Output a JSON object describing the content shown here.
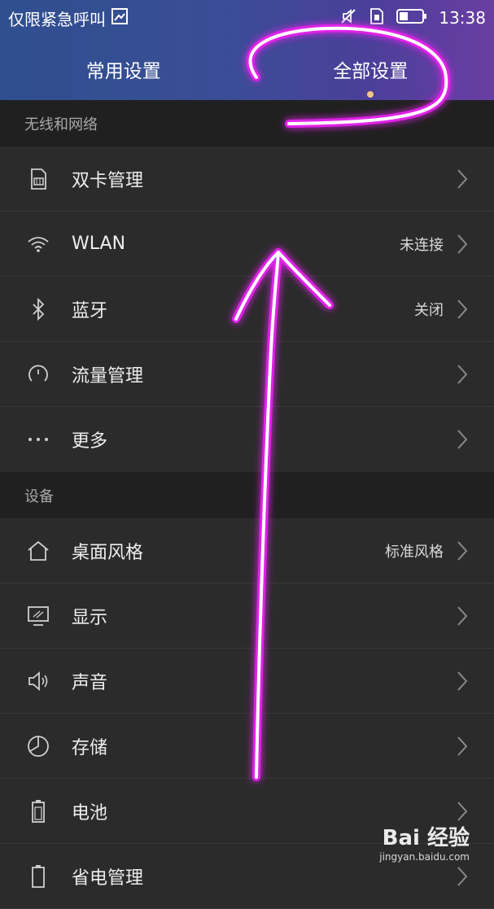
{
  "status_bar": {
    "carrier": "仅限紧急呼叫",
    "time": "13:38"
  },
  "tabs": [
    {
      "label": "常用设置",
      "active": false
    },
    {
      "label": "全部设置",
      "active": true
    }
  ],
  "sections": [
    {
      "header": "无线和网络",
      "items": [
        {
          "label": "双卡管理",
          "value": "",
          "icon": "sim-card-icon"
        },
        {
          "label": "WLAN",
          "value": "未连接",
          "icon": "wifi-icon"
        },
        {
          "label": "蓝牙",
          "value": "关闭",
          "icon": "bluetooth-icon"
        },
        {
          "label": "流量管理",
          "value": "",
          "icon": "data-usage-icon"
        },
        {
          "label": "更多",
          "value": "",
          "icon": "more-icon"
        }
      ]
    },
    {
      "header": "设备",
      "items": [
        {
          "label": "桌面风格",
          "value": "标准风格",
          "icon": "home-icon"
        },
        {
          "label": "显示",
          "value": "",
          "icon": "display-icon"
        },
        {
          "label": "声音",
          "value": "",
          "icon": "speaker-icon"
        },
        {
          "label": "存储",
          "value": "",
          "icon": "storage-pie-icon"
        },
        {
          "label": "电池",
          "value": "",
          "icon": "battery-icon"
        },
        {
          "label": "省电管理",
          "value": "",
          "icon": "power-saving-icon"
        }
      ]
    }
  ],
  "watermark": {
    "brand": "Bai 经验",
    "url": "jingyan.baidu.com"
  },
  "colors": {
    "annotation": "#e020e8",
    "tab_dot": "#f4c58a"
  }
}
